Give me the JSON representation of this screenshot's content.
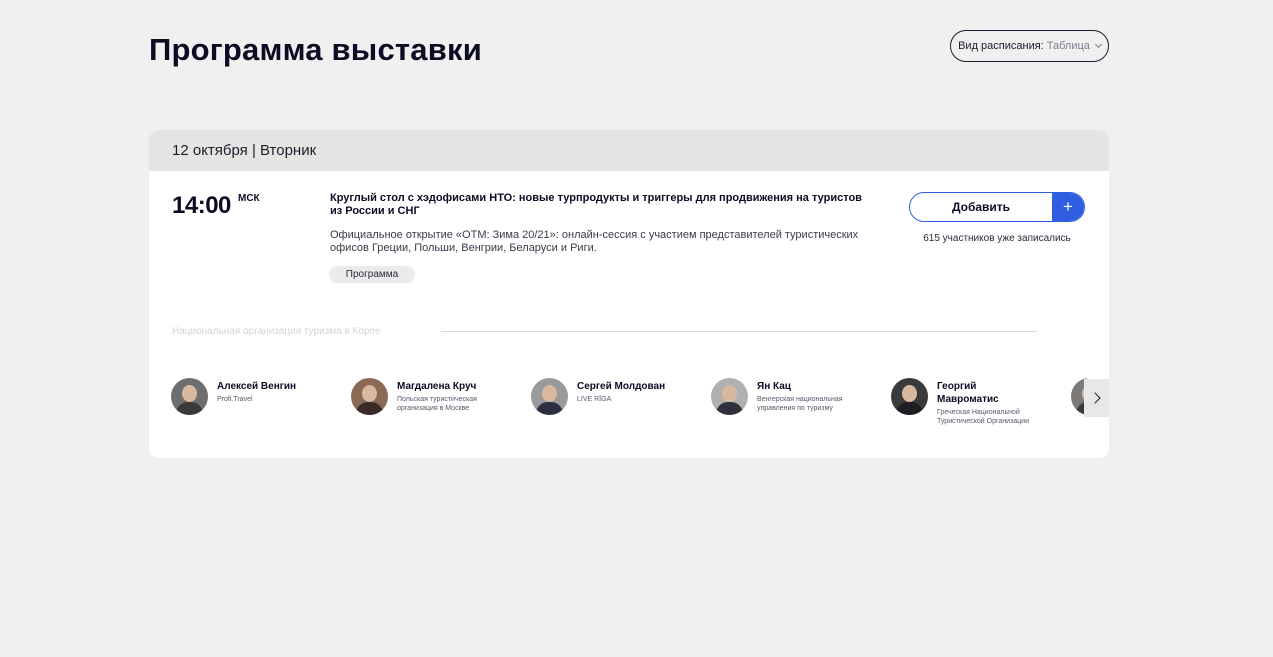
{
  "page": {
    "title": "Программа выставки"
  },
  "view_switch": {
    "label": "Вид расписания:",
    "value": "Таблица"
  },
  "day": {
    "header": "12 октября | Вторник"
  },
  "event": {
    "time": "14:00",
    "timezone": "МСК",
    "title": "Круглый стол с хэдофисами НТО: новые турпродукты и триггеры для продвижения на туристов из России и СНГ",
    "description": "Официальное открытие «ОТМ: Зима 20/21»: онлайн-сессия с участием представителей туристических офисов Греции, Польши, Венгрии, Беларуси и Риги.",
    "tag": "Программа",
    "add_label": "Добавить",
    "add_icon": "+",
    "participants": "615 участников уже записались",
    "org_section": "Национальная организация туризма в Корее"
  },
  "speakers": [
    {
      "name": "Алексей Венгин",
      "org": "Profi.Travel",
      "colors": [
        "#6e6e6e",
        "#3a3a3a"
      ]
    },
    {
      "name": "Магдалена Круч",
      "org": "Польская туристическая организация в Москве",
      "colors": [
        "#8a6a55",
        "#3a2a28"
      ]
    },
    {
      "name": "Сергей Молдован",
      "org": "LIVE RĪGA",
      "colors": [
        "#9a9a9a",
        "#2b3040"
      ]
    },
    {
      "name": "Ян Кац",
      "org": "Венгерская национальная управления по туризму",
      "colors": [
        "#b0b0b0",
        "#30303a"
      ]
    },
    {
      "name": "Георгий Мавроматис",
      "org": "Греческая Национальной Туристической Организации",
      "colors": [
        "#3a3a3a",
        "#1e1e22"
      ]
    },
    {
      "name": "",
      "org": "",
      "colors": [
        "#7a7a7a",
        "#3a3a3a"
      ]
    }
  ]
}
